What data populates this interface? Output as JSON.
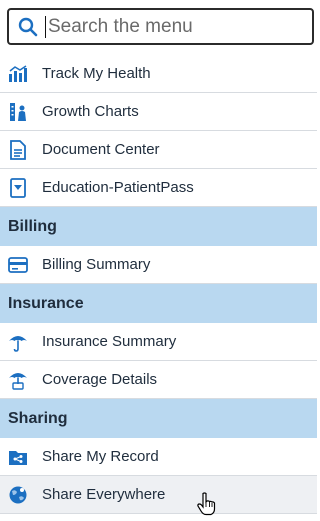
{
  "search": {
    "placeholder": "Search the menu",
    "icon": "search-icon"
  },
  "colors": {
    "accent": "#1c6fc1",
    "section_header_bg": "#b9d8f0",
    "divider": "#d7dbe0"
  },
  "menu": {
    "items_top": [
      {
        "label": "Track My Health",
        "icon": "chart-bars-icon"
      },
      {
        "label": "Growth Charts",
        "icon": "growth-chart-icon"
      },
      {
        "label": "Document Center",
        "icon": "document-icon"
      },
      {
        "label": "Education-PatientPass",
        "icon": "bookmark-shield-icon"
      }
    ],
    "billing": {
      "title": "Billing",
      "items": [
        {
          "label": "Billing Summary",
          "icon": "credit-card-icon"
        }
      ]
    },
    "insurance": {
      "title": "Insurance",
      "items": [
        {
          "label": "Insurance Summary",
          "icon": "umbrella-icon"
        },
        {
          "label": "Coverage Details",
          "icon": "umbrella-details-icon"
        }
      ]
    },
    "sharing": {
      "title": "Sharing",
      "items": [
        {
          "label": "Share My Record",
          "icon": "share-folder-icon"
        },
        {
          "label": "Share Everywhere",
          "icon": "globe-share-icon"
        }
      ]
    }
  }
}
